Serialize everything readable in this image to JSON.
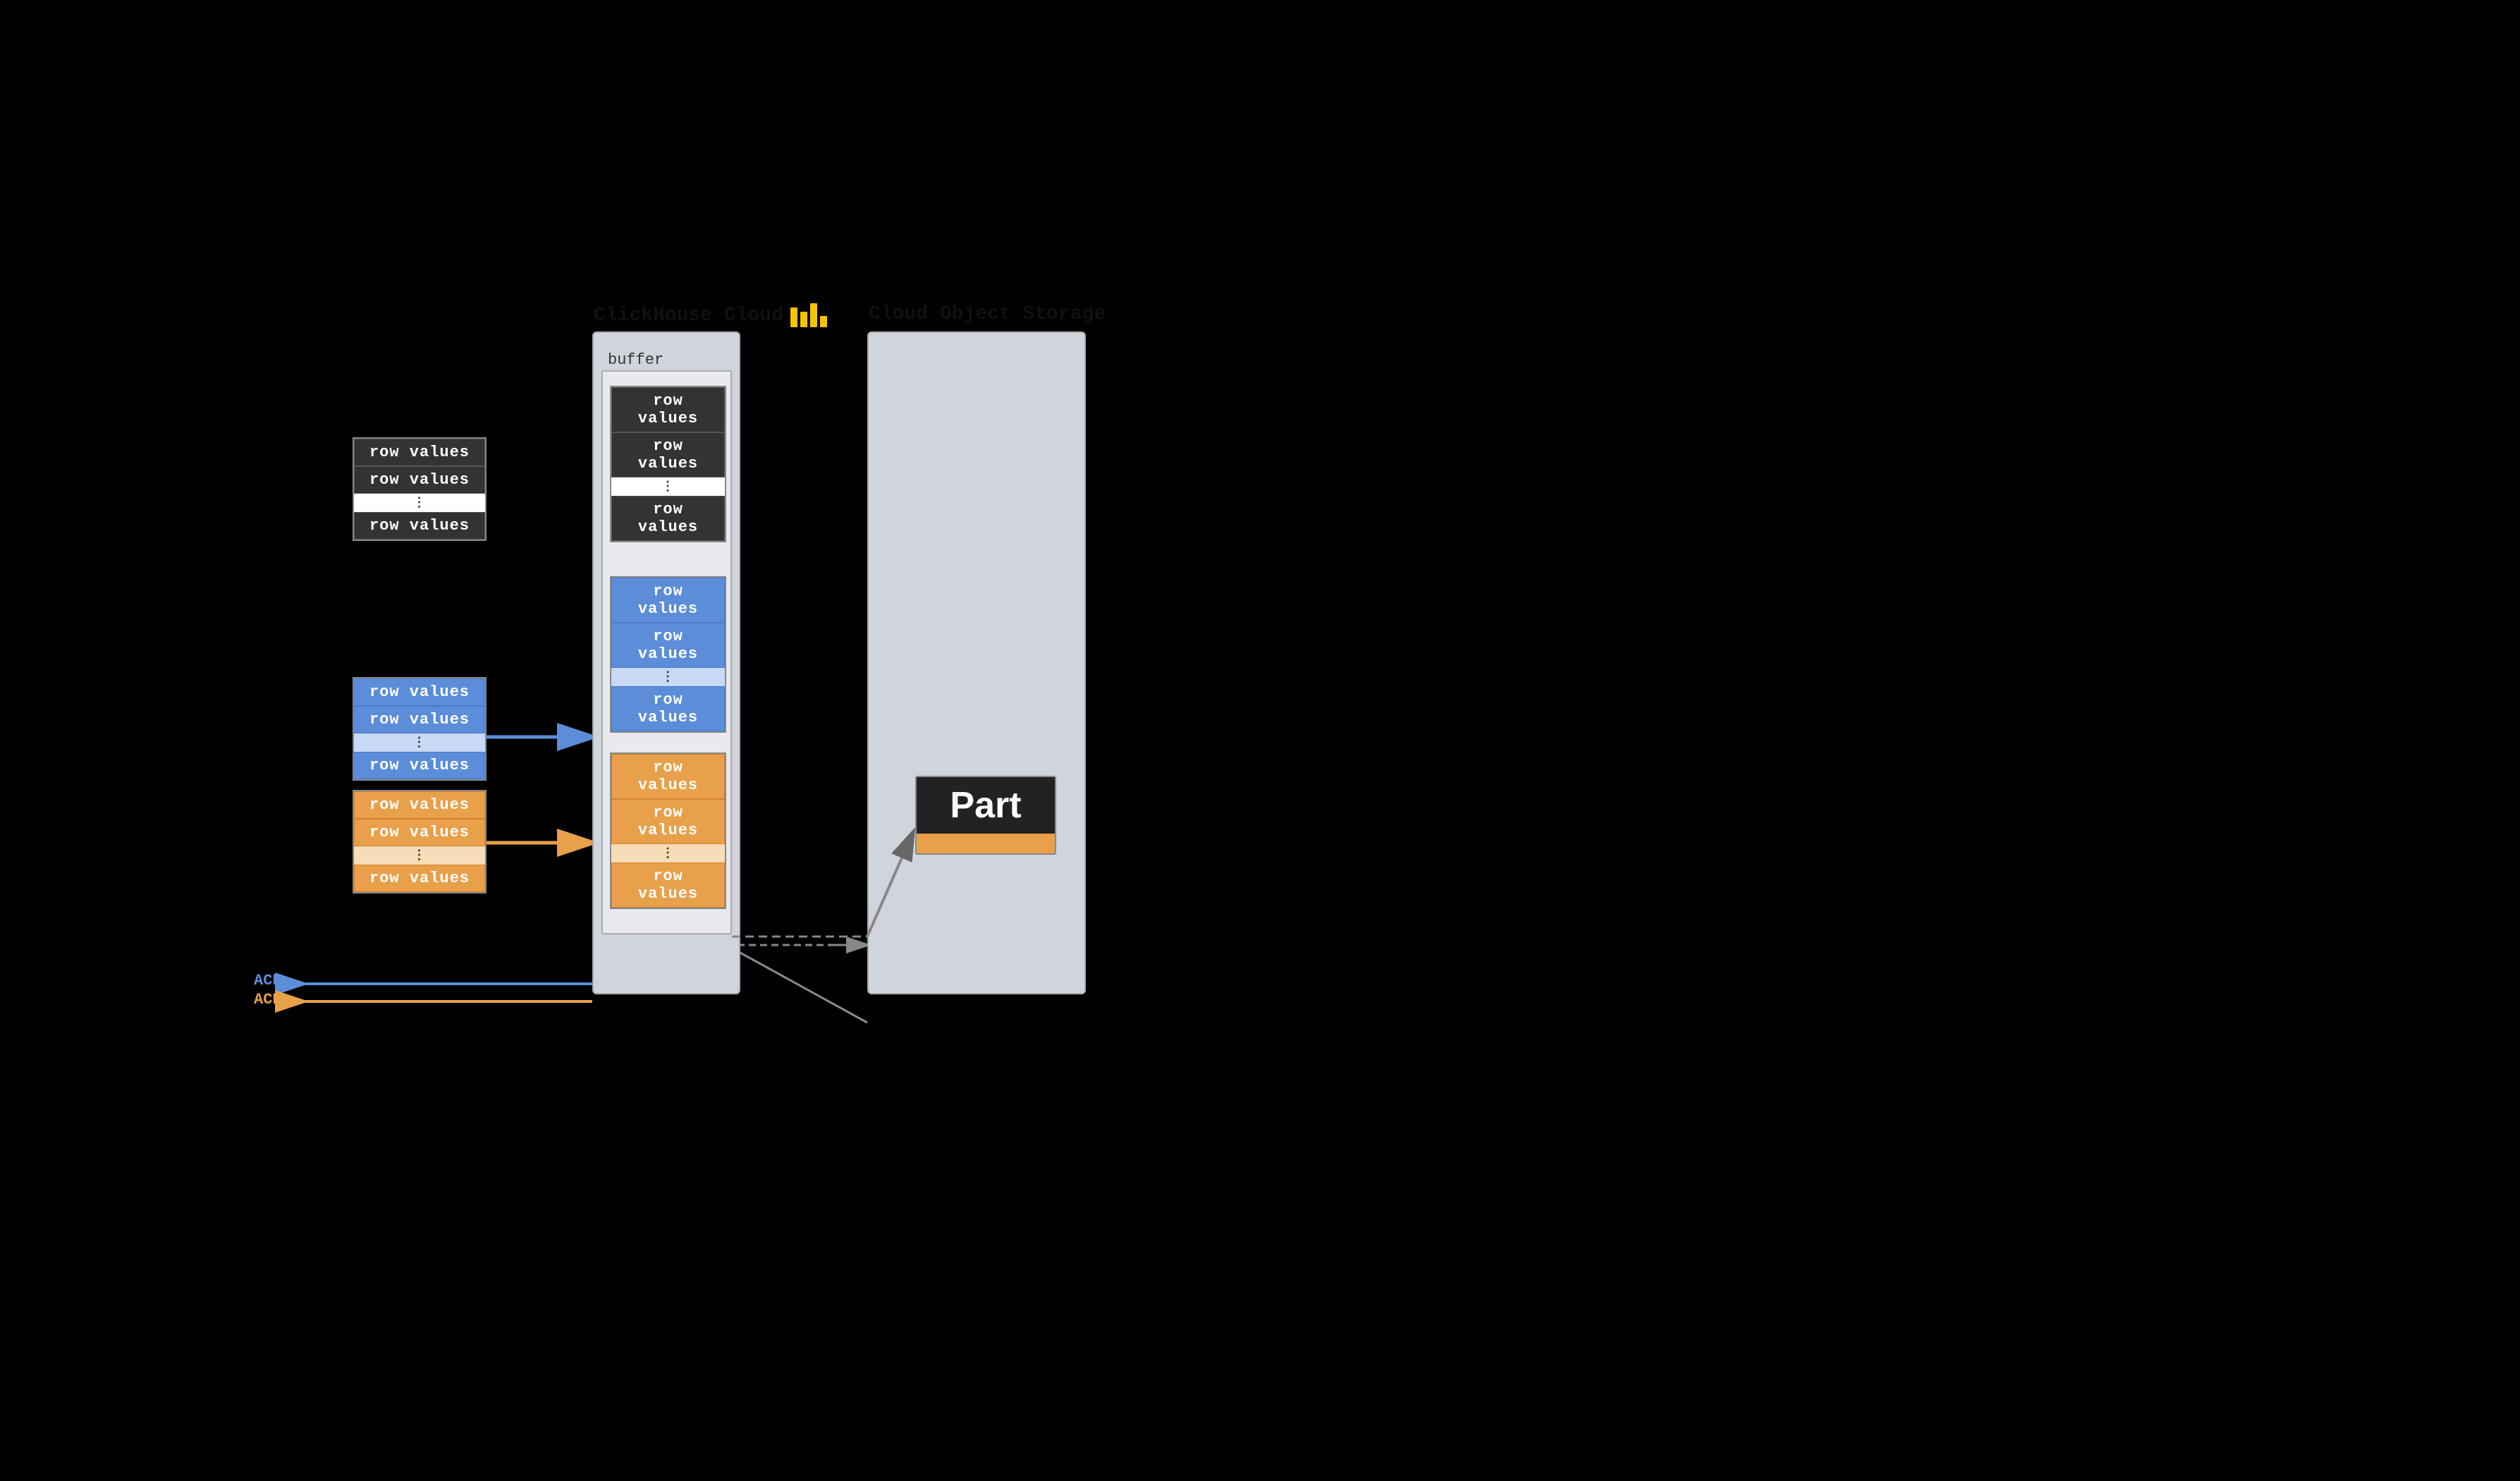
{
  "diagram": {
    "clickhouse_title": "ClickHouse Cloud",
    "cloud_storage_title": "Cloud Object Storage",
    "buffer_label": "buffer",
    "part_label": "Part",
    "ack_blue": "ACK",
    "ack_orange": "ACK",
    "row_values": "row values",
    "dots": "⋮",
    "colors": {
      "dark": "#333333",
      "blue": "#5b8dd9",
      "orange": "#e8a04a",
      "accent_yellow": "#f5c400"
    },
    "blocks": {
      "left_dark": {
        "rows": [
          "row values",
          "row values",
          "⋮",
          "row values"
        ],
        "style": [
          "dark",
          "dark",
          "dots",
          "dark"
        ]
      },
      "left_blue": {
        "rows": [
          "row values",
          "row values",
          "⋮",
          "row values"
        ],
        "style": [
          "blue",
          "blue",
          "dots-blue",
          "blue"
        ]
      },
      "left_orange": {
        "rows": [
          "row values",
          "row values",
          "⋮",
          "row values"
        ],
        "style": [
          "orange",
          "orange",
          "dots-orange",
          "orange"
        ]
      },
      "buffer_dark": {
        "rows": [
          "row values",
          "row values",
          "⋮",
          "row values"
        ],
        "style": [
          "dark",
          "dark",
          "dots",
          "dark"
        ]
      },
      "buffer_blue": {
        "rows": [
          "row values",
          "row values",
          "⋮",
          "row values"
        ],
        "style": [
          "blue",
          "blue",
          "dots-blue",
          "blue"
        ]
      },
      "buffer_orange": {
        "rows": [
          "row values",
          "row values",
          "⋮",
          "row values"
        ],
        "style": [
          "orange",
          "orange",
          "dots-orange",
          "orange"
        ]
      }
    }
  }
}
